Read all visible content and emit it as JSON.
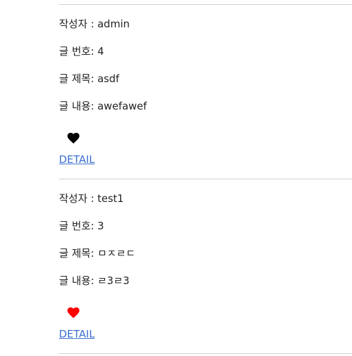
{
  "posts": [
    {
      "author": "작성자 : admin",
      "number": "글 번호: 4",
      "title": "글 제목: asdf",
      "content": "글 내용: awefawef",
      "liked": false,
      "heart_color": "#000000",
      "detail_label": "DETAIL"
    },
    {
      "author": "작성자 : test1",
      "number": "글 번호: 3",
      "title": "글 제목: ㅁㅈㄹㄷ",
      "content": "글 내용: ㄹ3ㄹ3",
      "liked": true,
      "heart_color": "#ff0000",
      "detail_label": "DETAIL"
    }
  ],
  "icons": {
    "like": "heart-icon"
  }
}
